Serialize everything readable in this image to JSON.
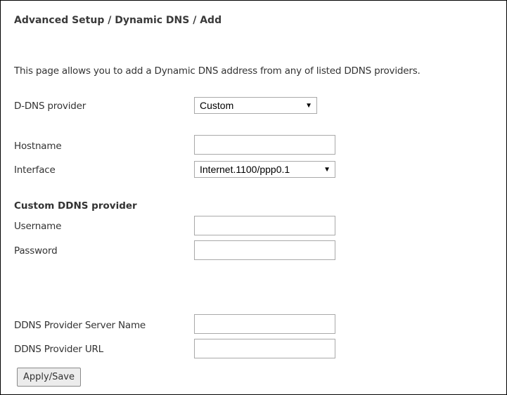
{
  "breadcrumb": "Advanced Setup / Dynamic DNS / Add",
  "intro": "This page allows you to add a Dynamic DNS address from any of listed DDNS providers.",
  "fields": {
    "provider": {
      "label": "D-DNS provider",
      "value": "Custom"
    },
    "hostname": {
      "label": "Hostname",
      "value": ""
    },
    "interface": {
      "label": "Interface",
      "value": "Internet.1100/ppp0.1"
    }
  },
  "custom_section": {
    "heading": "Custom DDNS provider",
    "username": {
      "label": "Username",
      "value": ""
    },
    "password": {
      "label": "Password",
      "value": ""
    },
    "server_name": {
      "label": "DDNS Provider Server Name",
      "value": ""
    },
    "url": {
      "label": "DDNS Provider URL",
      "value": ""
    }
  },
  "buttons": {
    "apply_save": "Apply/Save"
  }
}
